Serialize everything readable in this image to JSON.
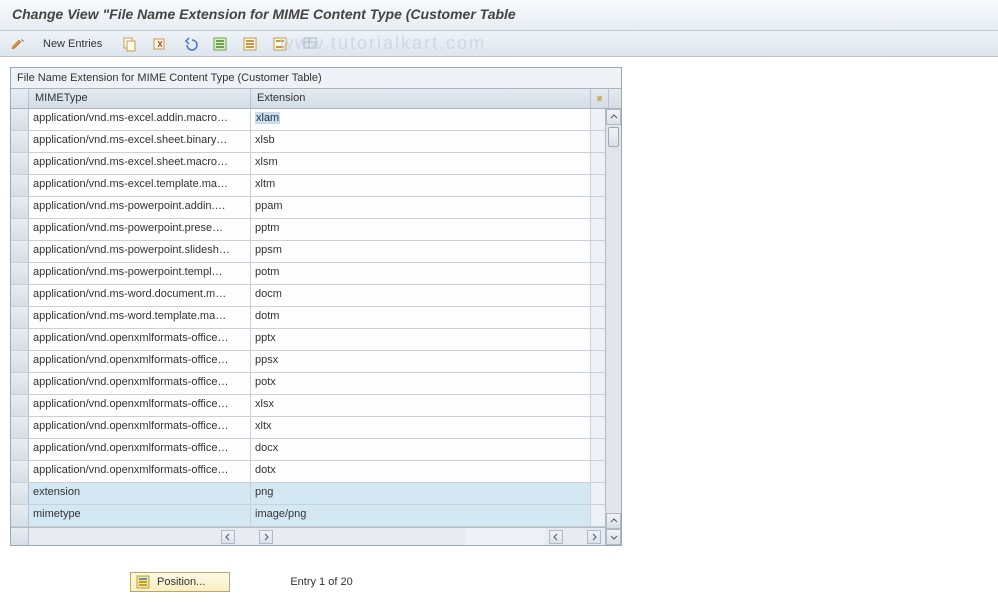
{
  "title": "Change View \"File Name Extension for MIME Content Type (Customer Table",
  "toolbar": {
    "new_entries_label": "New Entries"
  },
  "watermark": "www.tutorialkart.com",
  "table": {
    "title": "File Name Extension for MIME Content Type (Customer Table)",
    "columns": {
      "mime": "MIMEType",
      "ext": "Extension"
    },
    "rows": [
      {
        "mime": "application/vnd.ms-excel.addin.macro…",
        "ext": "xlam",
        "selected": true
      },
      {
        "mime": "application/vnd.ms-excel.sheet.binary…",
        "ext": "xlsb"
      },
      {
        "mime": "application/vnd.ms-excel.sheet.macro…",
        "ext": "xlsm"
      },
      {
        "mime": "application/vnd.ms-excel.template.ma…",
        "ext": "xltm"
      },
      {
        "mime": "application/vnd.ms-powerpoint.addin.…",
        "ext": "ppam"
      },
      {
        "mime": "application/vnd.ms-powerpoint.prese…",
        "ext": "pptm"
      },
      {
        "mime": "application/vnd.ms-powerpoint.slidesh…",
        "ext": "ppsm"
      },
      {
        "mime": "application/vnd.ms-powerpoint.templ…",
        "ext": "potm"
      },
      {
        "mime": "application/vnd.ms-word.document.m…",
        "ext": "docm"
      },
      {
        "mime": "application/vnd.ms-word.template.ma…",
        "ext": "dotm"
      },
      {
        "mime": "application/vnd.openxmlformats-office…",
        "ext": "pptx"
      },
      {
        "mime": "application/vnd.openxmlformats-office…",
        "ext": "ppsx"
      },
      {
        "mime": "application/vnd.openxmlformats-office…",
        "ext": "potx"
      },
      {
        "mime": "application/vnd.openxmlformats-office…",
        "ext": "xlsx"
      },
      {
        "mime": "application/vnd.openxmlformats-office…",
        "ext": "xltx"
      },
      {
        "mime": "application/vnd.openxmlformats-office…",
        "ext": "docx"
      },
      {
        "mime": "application/vnd.openxmlformats-office…",
        "ext": "dotx"
      },
      {
        "mime": "extension",
        "ext": "png",
        "new": true
      },
      {
        "mime": "mimetype",
        "ext": "image/png",
        "new": true
      }
    ]
  },
  "footer": {
    "position_label": "Position...",
    "entry_status": "Entry 1 of 20"
  }
}
